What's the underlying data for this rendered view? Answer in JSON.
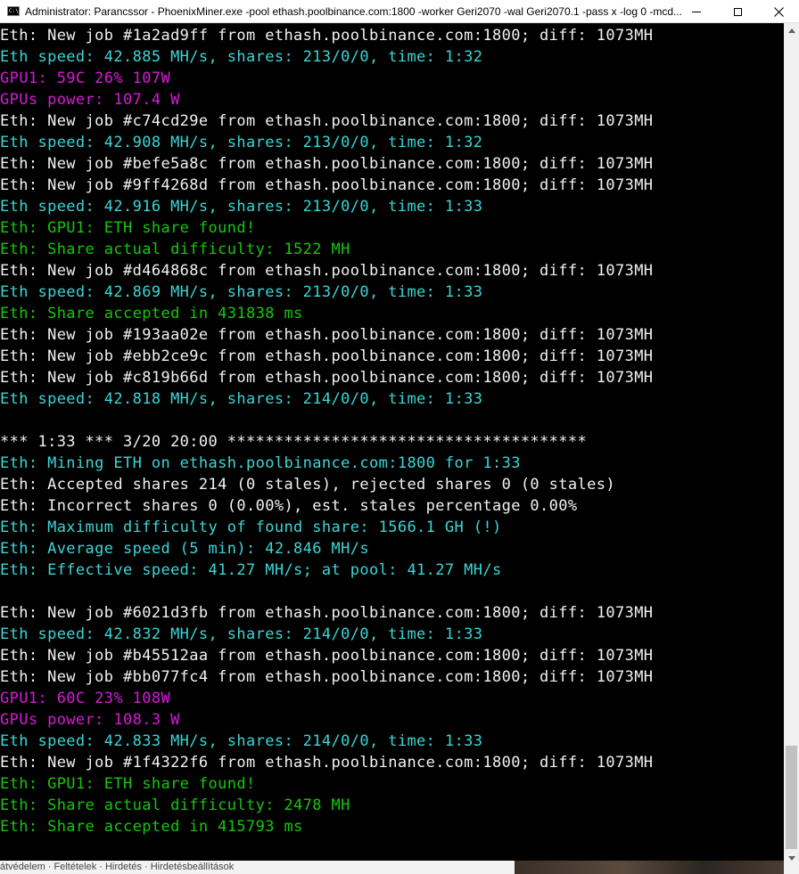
{
  "window": {
    "title": "Administrator: Parancssor - PhoenixMiner.exe  -pool ethash.poolbinance.com:1800 -worker Geri2070 -wal Geri2070.1 -pass x -log 0 -mcd...",
    "icon": "cmd-icon",
    "controls": [
      "minimize-icon",
      "maximize-icon",
      "close-icon"
    ]
  },
  "colors": {
    "background": "#000000",
    "white": "#f2f2f2",
    "cyan": "#3ad6d6",
    "green": "#16c60c",
    "magenta": "#d81ad8"
  },
  "console": {
    "lines": [
      {
        "text": "Eth: New job #1a2ad9ff from ethash.poolbinance.com:1800; diff: 1073MH",
        "color": "white"
      },
      {
        "text": "Eth speed: 42.885 MH/s, shares: 213/0/0, time: 1:32",
        "color": "cyan"
      },
      {
        "text": "GPU1: 59C 26% 107W",
        "color": "magenta"
      },
      {
        "text": "GPUs power: 107.4 W",
        "color": "magenta"
      },
      {
        "text": "Eth: New job #c74cd29e from ethash.poolbinance.com:1800; diff: 1073MH",
        "color": "white"
      },
      {
        "text": "Eth speed: 42.908 MH/s, shares: 213/0/0, time: 1:32",
        "color": "cyan"
      },
      {
        "text": "Eth: New job #befe5a8c from ethash.poolbinance.com:1800; diff: 1073MH",
        "color": "white"
      },
      {
        "text": "Eth: New job #9ff4268d from ethash.poolbinance.com:1800; diff: 1073MH",
        "color": "white"
      },
      {
        "text": "Eth speed: 42.916 MH/s, shares: 213/0/0, time: 1:33",
        "color": "cyan"
      },
      {
        "text": "Eth: GPU1: ETH share found!",
        "color": "green"
      },
      {
        "text": "Eth: Share actual difficulty: 1522 MH",
        "color": "green"
      },
      {
        "text": "Eth: New job #d464868c from ethash.poolbinance.com:1800; diff: 1073MH",
        "color": "white"
      },
      {
        "text": "Eth speed: 42.869 MH/s, shares: 213/0/0, time: 1:33",
        "color": "cyan"
      },
      {
        "text": "Eth: Share accepted in 431838 ms",
        "color": "green"
      },
      {
        "text": "Eth: New job #193aa02e from ethash.poolbinance.com:1800; diff: 1073MH",
        "color": "white"
      },
      {
        "text": "Eth: New job #ebb2ce9c from ethash.poolbinance.com:1800; diff: 1073MH",
        "color": "white"
      },
      {
        "text": "Eth: New job #c819b66d from ethash.poolbinance.com:1800; diff: 1073MH",
        "color": "white"
      },
      {
        "text": "Eth speed: 42.818 MH/s, shares: 214/0/0, time: 1:33",
        "color": "cyan"
      },
      {
        "text": "",
        "color": "white"
      },
      {
        "text": "*** 1:33 *** 3/20 20:00 **************************************",
        "color": "white"
      },
      {
        "text": "Eth: Mining ETH on ethash.poolbinance.com:1800 for 1:33",
        "color": "cyan"
      },
      {
        "text": "Eth: Accepted shares 214 (0 stales), rejected shares 0 (0 stales)",
        "color": "white"
      },
      {
        "text": "Eth: Incorrect shares 0 (0.00%), est. stales percentage 0.00%",
        "color": "white"
      },
      {
        "text": "Eth: Maximum difficulty of found share: 1566.1 GH (!)",
        "color": "cyan"
      },
      {
        "text": "Eth: Average speed (5 min): 42.846 MH/s",
        "color": "cyan"
      },
      {
        "text": "Eth: Effective speed: 41.27 MH/s; at pool: 41.27 MH/s",
        "color": "cyan"
      },
      {
        "text": "",
        "color": "white"
      },
      {
        "text": "Eth: New job #6021d3fb from ethash.poolbinance.com:1800; diff: 1073MH",
        "color": "white"
      },
      {
        "text": "Eth speed: 42.832 MH/s, shares: 214/0/0, time: 1:33",
        "color": "cyan"
      },
      {
        "text": "Eth: New job #b45512aa from ethash.poolbinance.com:1800; diff: 1073MH",
        "color": "white"
      },
      {
        "text": "Eth: New job #bb077fc4 from ethash.poolbinance.com:1800; diff: 1073MH",
        "color": "white"
      },
      {
        "text": "GPU1: 60C 23% 108W",
        "color": "magenta"
      },
      {
        "text": "GPUs power: 108.3 W",
        "color": "magenta"
      },
      {
        "text": "Eth speed: 42.833 MH/s, shares: 214/0/0, time: 1:33",
        "color": "cyan"
      },
      {
        "text": "Eth: New job #1f4322f6 from ethash.poolbinance.com:1800; diff: 1073MH",
        "color": "white"
      },
      {
        "text": "Eth: GPU1: ETH share found!",
        "color": "green"
      },
      {
        "text": "Eth: Share actual difficulty: 2478 MH",
        "color": "green"
      },
      {
        "text": "Eth: Share accepted in 415793 ms",
        "color": "green"
      }
    ]
  },
  "background_window": {
    "text": "átvédelem · Feltételek · Hirdetés · Hirdetésbeállítások"
  }
}
